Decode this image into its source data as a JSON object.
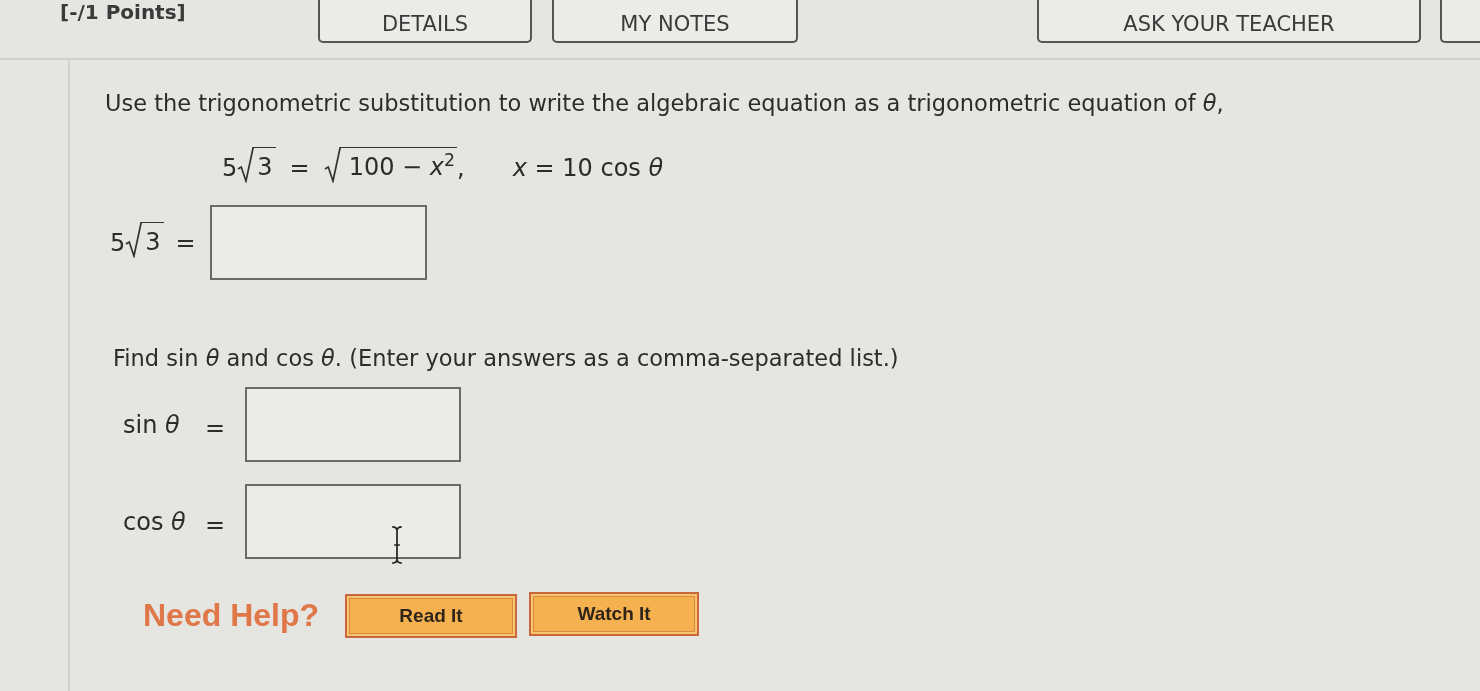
{
  "header": {
    "points": "[-/1 Points]",
    "buttons": [
      "DETAILS",
      "MY NOTES",
      "ASK YOUR TEACHER"
    ]
  },
  "question": {
    "prompt": "Use the trigonometric substitution to write the algebraic equation as a trigonometric equation of *θ*,",
    "equation": {
      "coefficient": "5",
      "radicand": "3",
      "equals": "=",
      "rhs_radicand": "100 − *x*$^{2}$",
      "comma": ",",
      "substitution": "*x* = 10 cos *θ*"
    },
    "answer_row": {
      "coefficient": "5",
      "radicand": "3",
      "equals": "="
    },
    "instruction": "Find sin *θ* and cos *θ*. (Enter your answers as a comma-separated list.)",
    "answers": [
      {
        "label": "sin *θ*",
        "equals": "="
      },
      {
        "label": "cos *θ*",
        "equals": "="
      }
    ]
  },
  "help": {
    "label": "Need Help?",
    "buttons": [
      "Read It",
      "Watch It"
    ]
  }
}
